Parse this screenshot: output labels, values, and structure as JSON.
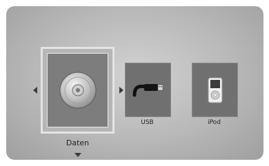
{
  "menu": {
    "items": [
      {
        "label": "Daten",
        "icon": "disc-icon",
        "selected": true
      },
      {
        "label": "USB",
        "icon": "usb-icon",
        "selected": false
      },
      {
        "label": "iPod",
        "icon": "ipod-icon",
        "selected": false
      }
    ]
  },
  "colors": {
    "screen_background": "#b8b8b8",
    "tile": "#707070",
    "selected_border": "#e4e4e4",
    "text": "#222222"
  }
}
